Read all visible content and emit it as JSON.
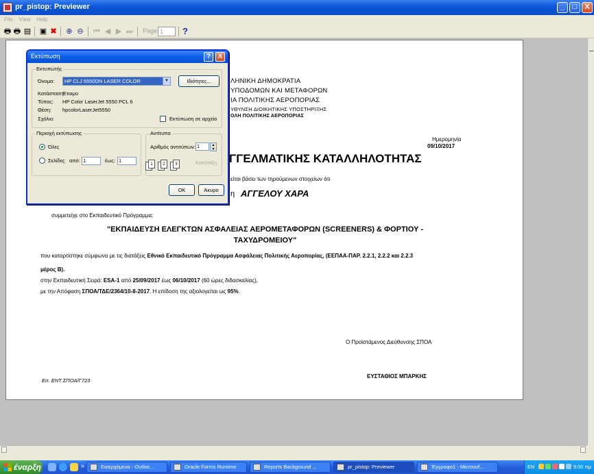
{
  "window": {
    "title": "pr_pistop: Previewer",
    "min": "_",
    "max": "□",
    "close": "X"
  },
  "menu": [
    "File",
    "View",
    "Help"
  ],
  "toolbar": {
    "page_label": "Page:",
    "page_value": "1",
    "help_label": "?",
    "icons": [
      "printer-icon",
      "print-setup-icon",
      "export-icon",
      "close-preview-icon",
      "zoom-in-icon",
      "zoom-out-icon",
      "first-page-icon",
      "prev-page-icon",
      "next-page-icon",
      "last-page-icon"
    ]
  },
  "report": {
    "header_lines": [
      "ΛΗΝΙΚΗ ΔΗΜΟΚΡΑΤΙΑ",
      "ΥΠΟΔΟΜΩΝ ΚΑΙ ΜΕΤΑΦΟΡΩΝ",
      "ΙΑ ΠΟΛΙΤΙΚΗΣ ΑΕΡΟΠΟΡΙΑΣ",
      "ΥΘΥΝΣΗ ΔΙΟΙΚΗΤΙΚΗΣ ΥΠΟΣΤΗΡΙΞΗΣ",
      "ΟΛΗ ΠΟΛΙΤΙΚΗΣ ΑΕΡΟΠΟΡΙΑΣ"
    ],
    "date_label": "Ημερομηνία",
    "date_value": "09/10/2017",
    "cert_title": "ΓΓΕΛΜΑΤΙΚΗΣ ΚΑΤΑΛΛΗΛΟΤΗΤΑΣ",
    "intro_text": "είται βάσει των τηρούμενων στοιχείων ότι",
    "name_prefix": "η",
    "name": "ΑΓΓΕΛΟΥ ΧΑΡΑ",
    "participated": "συμμετείχε στο Εκπαιδευτικό Πρόγραμμα:",
    "program_line1": "\"ΕΚΠΑΙΔΕΥΣΗ ΕΛΕΓΚΤΩΝ ΑΣΦΑΛΕΙΑΣ ΑΕΡΟΜΕΤΑΦΟΡΩΝ (SCREENERS) & ΦΟΡΤΙΟΥ -",
    "program_line2": "ΤΑΧΥΔΡΟΜΕΙΟΥ\"",
    "compiled_prefix": "που καταρτίστηκε σύμφωνα με τις διατάξεις ",
    "compiled_bold": "Εθνικό Εκπαιδευτικό Πρόγραμμα Ασφάλειας Πολιτικής Αεροπορίας, (ΕΕΠΑΑ-ΠΑΡ. 2.2.1, 2.2.2 και 2.2.3",
    "compiled_bold2": "μέρος Β).",
    "series_prefix": "στην Εκπαιδευτική Σειρά: ",
    "series_code": "ESA-1",
    "series_from": " από ",
    "series_start": "25/09/2017",
    "series_to": " έως ",
    "series_end": "06/10/2017",
    "series_hours": " (60 ώρες διδασκαλίας),",
    "decision_prefix": "με την Απόφαση ",
    "decision_code": "ΣΠΟΑ/ΤΔΕ/2364/10-8-2017",
    "decision_mid": ". Η επίδοση της αξιολογείται ως  ",
    "decision_score": "95%",
    "decision_end": ".",
    "signature_title": "Ο Προϊστάμενος Διεύθυνσης ΣΠΟΑ",
    "signature_name": "ΕΥΣΤΑΘΙΟΣ ΜΠΑΡΚΗΣ",
    "reference": "Εσ. ΕΝΤ ΣΠΟΑ/Γ723"
  },
  "print_dialog": {
    "title": "Εκτύπωση",
    "help": "?",
    "close": "X",
    "printer_group": "Εκτυπωτής",
    "name_label": "Όνομα:",
    "printer_name": "HP CLJ 5550DN  LASER COLOR",
    "properties_button": "Ιδιότητες...",
    "status_label": "Κατάσταση:",
    "status_value": "Έτοιμο",
    "type_label": "Τύπος:",
    "type_value": "HP Color LaserJet 5550 PCL 6",
    "where_label": "Θέση:",
    "where_value": "hpcolorLaserJet5550",
    "comment_label": "Σχόλιο:",
    "print_to_file": "Εκτύπωση σε αρχείο",
    "range_group": "Περιοχή εκτύπωσης",
    "all_label": "Όλες",
    "pages_label": "Σελίδες",
    "from_label": "από:",
    "from_value": "1",
    "to_label": "έως:",
    "to_value": "1",
    "copies_group": "Αντίτυπα",
    "copies_label": "Αριθμός αντιτύπων:",
    "copies_value": "1",
    "collate_label": "Κατάταξη",
    "ok_button": "OK",
    "cancel_button": "Άκυρο"
  },
  "taskbar": {
    "start": "έναρξη",
    "more": "»",
    "tasks": [
      "Εισερχόμενα - Outloo...",
      "Oracle Forms Runtime",
      "Reports Background ...",
      "pr_pistop: Previewer",
      "Έγγραφο1 - Microsof..."
    ],
    "active_task": 3,
    "language": "EN",
    "clock": "9:00 πμ"
  },
  "colors": {
    "title_blue": "#0a55d8",
    "start_green": "#2f8a2a",
    "workspace": "#c0c0c0"
  }
}
